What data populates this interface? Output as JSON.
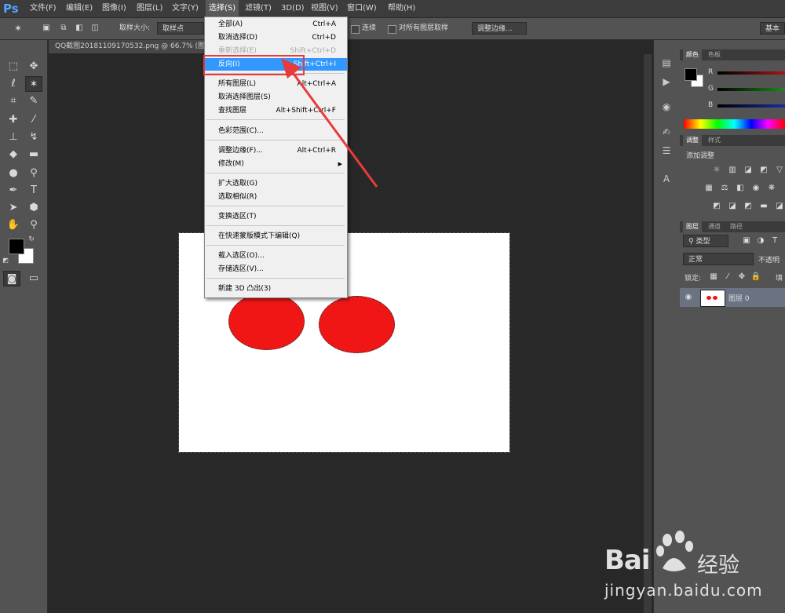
{
  "app": {
    "logo": "Ps"
  },
  "menubar": [
    {
      "label": "文件(F)"
    },
    {
      "label": "编辑(E)"
    },
    {
      "label": "图像(I)"
    },
    {
      "label": "图层(L)"
    },
    {
      "label": "文字(Y)"
    },
    {
      "label": "选择(S)"
    },
    {
      "label": "滤镜(T)"
    },
    {
      "label": "3D(D)"
    },
    {
      "label": "视图(V)"
    },
    {
      "label": "窗口(W)"
    },
    {
      "label": "帮助(H)"
    }
  ],
  "options": {
    "sample_size_label": "取样大小:",
    "sample_size_value": "取样点",
    "contiguous_label": "连续",
    "all_layers_label": "对所有图层取样",
    "refine_edge": "调整边缘...",
    "workspace": "基本"
  },
  "document": {
    "tab_title": "QQ截图20181109170532.png @ 66.7% (图"
  },
  "select_menu": {
    "items": [
      {
        "label": "全部(A)",
        "shortcut": "Ctrl+A"
      },
      {
        "label": "取消选择(D)",
        "shortcut": "Ctrl+D"
      },
      {
        "label": "重新选择(E)",
        "shortcut": "Shift+Ctrl+D"
      },
      {
        "label": "反向(I)",
        "shortcut": "Shift+Ctrl+I"
      },
      {
        "label": "所有图层(L)",
        "shortcut": "Alt+Ctrl+A"
      },
      {
        "label": "取消选择图层(S)",
        "shortcut": ""
      },
      {
        "label": "查找图层",
        "shortcut": "Alt+Shift+Ctrl+F"
      },
      {
        "label": "色彩范围(C)...",
        "shortcut": ""
      },
      {
        "label": "调整边缘(F)...",
        "shortcut": "Alt+Ctrl+R"
      },
      {
        "label": "修改(M)",
        "shortcut": ""
      },
      {
        "label": "扩大选取(G)",
        "shortcut": ""
      },
      {
        "label": "选取相似(R)",
        "shortcut": ""
      },
      {
        "label": "变换选区(T)",
        "shortcut": ""
      },
      {
        "label": "在快速蒙版模式下编辑(Q)",
        "shortcut": ""
      },
      {
        "label": "载入选区(O)...",
        "shortcut": ""
      },
      {
        "label": "存储选区(V)...",
        "shortcut": ""
      },
      {
        "label": "新建 3D 凸出(3)",
        "shortcut": ""
      }
    ]
  },
  "color_panel": {
    "tabs": [
      "颜色",
      "色板"
    ],
    "channels": [
      {
        "name": "R",
        "value": "0",
        "color": "#e02020"
      },
      {
        "name": "G",
        "value": "0",
        "color": "#20c020"
      },
      {
        "name": "B",
        "value": "0",
        "color": "#2040e0"
      }
    ]
  },
  "adjust_panel": {
    "tabs": [
      "调整",
      "样式"
    ],
    "title": "添加调整"
  },
  "layers_panel": {
    "tabs": [
      "图层",
      "通道",
      "路径"
    ],
    "filter": "类型",
    "blend_mode": "正常",
    "opacity_label": "不透明",
    "lock_label": "锁定:",
    "fill_label": "填",
    "layer_name": "图层 0"
  },
  "watermark": {
    "brand": "Bai",
    "brand_cn": "经验",
    "url": "jingyan.baidu.com"
  },
  "colors": {
    "selection_fill": "#f01616",
    "menu_highlight": "#3298fe",
    "annotation": "#e83b3b"
  }
}
